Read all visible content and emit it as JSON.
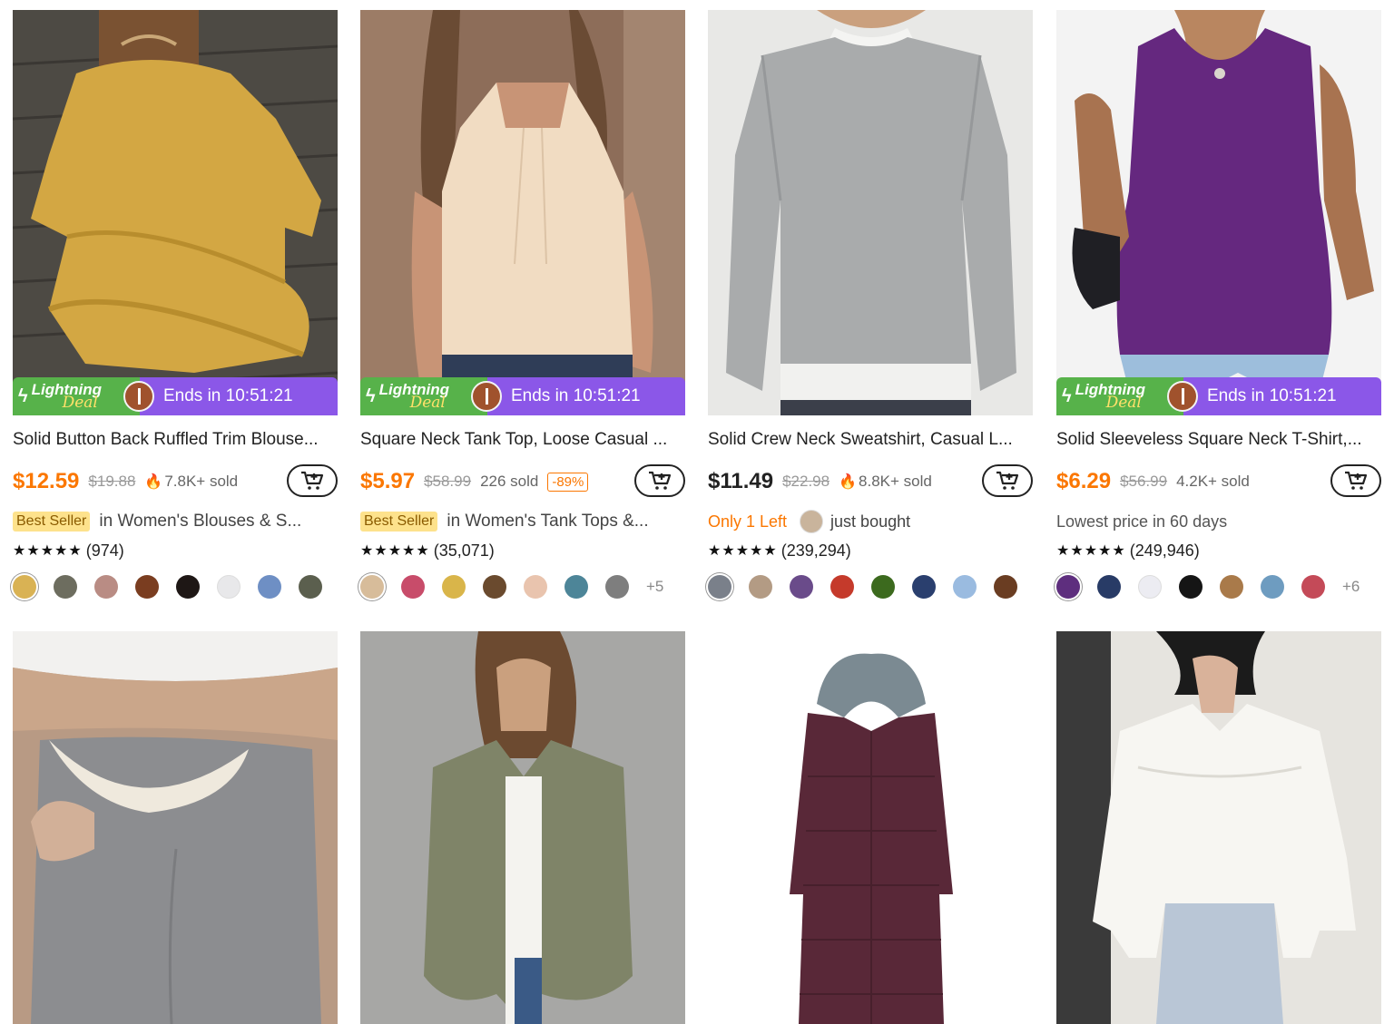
{
  "products": [
    {
      "title": "Solid Button Back Ruffled Trim Blouse...",
      "deal": {
        "brand_top": "Lightning",
        "brand_bottom": "Deal",
        "ends": "Ends in 10:51:21"
      },
      "price": "$12.59",
      "price_color": "#fb7701",
      "original": "$19.88",
      "sold": "7.8K+ sold",
      "discount": "",
      "badge": "Best Seller",
      "category": "in Women's Blouses & S...",
      "stars": "★★★★★",
      "reviews": "(974)",
      "swatches": [
        "#d9b254",
        "#6d6d5f",
        "#b98c84",
        "#7a3d20",
        "#1e1715",
        "#e8e8ea",
        "#6e8fc4",
        "#5b5f4e"
      ],
      "more": ""
    },
    {
      "title": "Square Neck Tank Top, Loose Casual ...",
      "deal": {
        "brand_top": "Lightning",
        "brand_bottom": "Deal",
        "ends": "Ends in 10:51:21"
      },
      "price": "$5.97",
      "price_color": "#fb7701",
      "original": "$58.99",
      "sold": "226 sold",
      "discount": "-89%",
      "badge": "Best Seller",
      "category": "in Women's Tank Tops &...",
      "stars": "★★★★★",
      "reviews": "(35,071)",
      "swatches": [
        "#d7bc9a",
        "#c84c6a",
        "#d9b54a",
        "#6a4a2e",
        "#e9c4ae",
        "#4d8598",
        "#7e7e7e"
      ],
      "more": "+5"
    },
    {
      "title": "Solid Crew Neck Sweatshirt, Casual L...",
      "deal": null,
      "price": "$11.49",
      "price_color": "#222222",
      "original": "$22.98",
      "sold": "8.8K+ sold",
      "discount": "",
      "low_stock": "Only 1 Left",
      "bought": "just bought",
      "stars": "★★★★★",
      "reviews": "(239,294)",
      "swatches": [
        "#7a808a",
        "#b39b84",
        "#6a4b8a",
        "#c53a2b",
        "#3c6a1e",
        "#2a3f6e",
        "#9abbe0",
        "#6a3d22"
      ],
      "more": ""
    },
    {
      "title": "Solid Sleeveless Square Neck T-Shirt,...",
      "deal": {
        "brand_top": "Lightning",
        "brand_bottom": "Deal",
        "ends": "Ends in 10:51:21"
      },
      "price": "$6.29",
      "price_color": "#fb7701",
      "original": "$56.99",
      "sold": "4.2K+ sold",
      "discount": "",
      "lowest": "Lowest price in 60 days",
      "stars": "★★★★★",
      "reviews": "(249,946)",
      "swatches": [
        "#5e2e7e",
        "#283b66",
        "#ececf2",
        "#151515",
        "#a97a4a",
        "#6e9cc0",
        "#c44a58"
      ],
      "more": "+6"
    }
  ],
  "row2": [
    {
      "name": "gray-fleece-leggings"
    },
    {
      "name": "olive-denim-jacket"
    },
    {
      "name": "burgundy-long-puffer-coat"
    },
    {
      "name": "white-lace-blouse"
    }
  ]
}
